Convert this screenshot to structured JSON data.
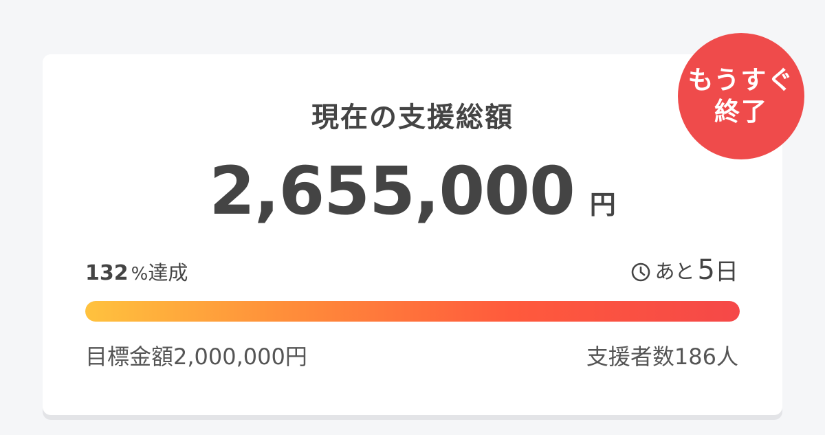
{
  "badge": {
    "line1": "もうすぐ",
    "line2": "終了"
  },
  "title": "現在の支援総額",
  "amount": {
    "value": "2,655,000",
    "unit": "円"
  },
  "progress": {
    "percent_value": "132",
    "percent_unit": "%",
    "percent_suffix": "達成",
    "fill_ratio": 1.0
  },
  "remaining": {
    "prefix": "あと",
    "days": "5",
    "unit": "日"
  },
  "goal": "目標金額2,000,000円",
  "supporters": "支援者数186人",
  "colors": {
    "badge": "#ef4b4b",
    "bar_start": "#ffc23e",
    "bar_end": "#f54848",
    "text": "#444444"
  },
  "icons": {
    "remaining": "clock-icon"
  }
}
